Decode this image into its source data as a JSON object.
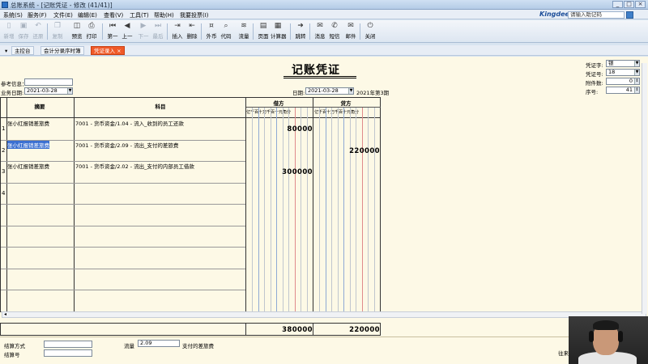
{
  "window": {
    "title": "总账系统 - [记账凭证 - 修改 (41/41)]",
    "controls": [
      "_",
      "□",
      "×"
    ]
  },
  "menubar": {
    "items": [
      "系统(S)",
      "服务(F)",
      "文件(E)",
      "编辑(E)",
      "查看(V)",
      "工具(T)",
      "帮助(H)",
      "我要投票(I)"
    ],
    "brand": "Kingdee",
    "search_placeholder": "请输入助记码"
  },
  "toolbar": {
    "buttons": [
      {
        "label": "新增",
        "icon": "new-icon",
        "glyph": "▯",
        "enabled": false
      },
      {
        "label": "保存",
        "icon": "save-icon",
        "glyph": "▣",
        "enabled": false
      },
      {
        "label": "还原",
        "icon": "undo-icon",
        "glyph": "↶",
        "enabled": false
      },
      {
        "label": "复制",
        "icon": "copy-icon",
        "glyph": "❐",
        "enabled": false
      },
      {
        "label": "预览",
        "icon": "preview-icon",
        "glyph": "◫",
        "enabled": true
      },
      {
        "label": "打印",
        "icon": "print-icon",
        "glyph": "⎙",
        "enabled": true
      },
      {
        "label": "第一",
        "icon": "first-icon",
        "glyph": "⏮",
        "enabled": true
      },
      {
        "label": "上一",
        "icon": "prev-icon",
        "glyph": "◀",
        "enabled": true
      },
      {
        "label": "下一",
        "icon": "next-icon",
        "glyph": "▶",
        "enabled": false
      },
      {
        "label": "最后",
        "icon": "last-icon",
        "glyph": "⏭",
        "enabled": false
      },
      {
        "label": "插入",
        "icon": "insert-row-icon",
        "glyph": "⇥",
        "enabled": true
      },
      {
        "label": "删除",
        "icon": "delete-row-icon",
        "glyph": "⇤",
        "enabled": true
      },
      {
        "label": "外币",
        "icon": "currency-icon",
        "glyph": "¤",
        "enabled": true
      },
      {
        "label": "代码",
        "icon": "code-icon",
        "glyph": "⌕",
        "enabled": true
      },
      {
        "label": "流量",
        "icon": "cashflow-icon",
        "glyph": "≋",
        "enabled": true
      },
      {
        "label": "页面",
        "icon": "page-icon",
        "glyph": "▤",
        "enabled": true
      },
      {
        "label": "计算器",
        "icon": "calculator-icon",
        "glyph": "▦",
        "enabled": true
      },
      {
        "label": "跳转",
        "icon": "jump-icon",
        "glyph": "➜",
        "enabled": true
      },
      {
        "label": "消息",
        "icon": "message-icon",
        "glyph": "✉",
        "enabled": true
      },
      {
        "label": "短信",
        "icon": "sms-icon",
        "glyph": "✆",
        "enabled": true
      },
      {
        "label": "邮件",
        "icon": "mail-icon",
        "glyph": "✉",
        "enabled": true
      },
      {
        "label": "关闭",
        "icon": "close-icon",
        "glyph": "⏻",
        "enabled": true
      }
    ]
  },
  "tabs": [
    {
      "label": "▾",
      "active": false
    },
    {
      "label": "主控台",
      "active": false
    },
    {
      "label": "会计分录序时簿",
      "active": false
    },
    {
      "label": "凭证录入 ×",
      "active": true
    }
  ],
  "voucher": {
    "title": "记账凭证",
    "reference_label": "参考信息：",
    "reference_value": "",
    "business_date_label": "业务日期:",
    "business_date": "2021-03-28",
    "date_label": "日期:",
    "date": "2021-03-28",
    "period": "2021年第3期",
    "voucher_word_label": "凭证字:",
    "voucher_word": "银",
    "voucher_no_label": "凭证号:",
    "voucher_no": "18",
    "attachments_label": "附件数:",
    "attachments": "0",
    "serial_label": "序号:",
    "serial": "41"
  },
  "grid": {
    "headers": {
      "summary": "摘要",
      "account": "科目",
      "debit": "借方",
      "credit": "贷方"
    },
    "digit_header": "亿千百十万千百十元角分",
    "rows": [
      {
        "no": "1",
        "summary": "张小红报销差旅费",
        "account": "7001 - 货币资金/1.04 - 流入_收到的员工还款",
        "debit": "80000",
        "credit": "",
        "selected": false
      },
      {
        "no": "2",
        "summary": "张小红报销差旅费",
        "account": "7001 - 货币资金/2.09 - 流出_支付的差旅费",
        "debit": "",
        "credit": "220000",
        "selected": true
      },
      {
        "no": "3",
        "summary": "张小红报销差旅费",
        "account": "7001 - 货币资金/2.02 - 流出_支付的内部员工借款",
        "debit": "300000",
        "credit": "",
        "selected": false
      },
      {
        "no": "4",
        "summary": "",
        "account": "",
        "debit": "",
        "credit": "",
        "selected": false
      }
    ],
    "totals": {
      "debit": "380000",
      "credit": "220000"
    }
  },
  "footer": {
    "settlement_method_label": "结算方式",
    "settlement_method": "",
    "settlement_no_label": "结算号",
    "settlement_no": "",
    "flow_label": "流量",
    "flow_code": "2.09",
    "flow_desc": "支付的差旅费",
    "right_label": "往来"
  },
  "colors": {
    "active_tab": "#f05a28",
    "selection": "#3a6fd1",
    "voucher_bg": "#fdf9e6"
  }
}
